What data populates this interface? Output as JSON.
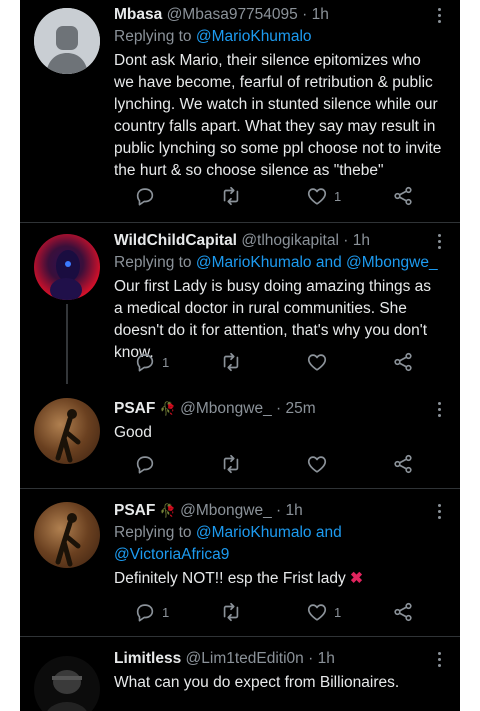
{
  "tweets": [
    {
      "name": "Mbasa",
      "handle": "@Mbasa97754095",
      "time": "· 1h",
      "replying_prefix": "Replying to ",
      "replying_to": "@MarioKhumalo",
      "text": "Dont ask Mario, their silence epitomizes who we have become, fearful of retribution & public lynching. We watch in stunted silence while our country falls apart. What they say may result in public lynching so some ppl choose not to invite the hurt & so choose silence as \"thebe\"",
      "replies": "",
      "retweets": "",
      "likes": "1"
    },
    {
      "name": "WildChildCapital",
      "handle": "@tlhogikapital",
      "time": "· 1h",
      "replying_prefix": "Replying to ",
      "replying_to": "@MarioKhumalo and @Mbongwe_",
      "text": "Our first Lady is busy doing amazing things as a medical doctor in rural communities. She doesn't do it for attention, that's why you don't know.",
      "replies": "1",
      "retweets": "",
      "likes": ""
    },
    {
      "name": "PSAF",
      "name_emoji": "🥀",
      "handle": "@Mbongwe_",
      "time": "· 25m",
      "text": "Good",
      "replies": "",
      "retweets": "",
      "likes": ""
    },
    {
      "name": "PSAF",
      "name_emoji": "🥀",
      "handle": "@Mbongwe_",
      "time": "· 1h",
      "replying_prefix": "Replying to ",
      "replying_to_line1": "@MarioKhumalo and",
      "replying_to_line2": "@VictoriaAfrica9",
      "text": "Definitely NOT!! esp the Frist lady",
      "text_emoji": "✖",
      "replies": "1",
      "retweets": "",
      "likes": "1"
    },
    {
      "name": "Limitless",
      "handle": "@Lim1tedEditi0n",
      "time": "· 1h",
      "text": "What can you do expect from Billionaires."
    }
  ],
  "icons": {
    "reply": "reply-icon",
    "retweet": "retweet-icon",
    "like": "heart-icon",
    "share": "share-icon",
    "more": "more-icon"
  },
  "colors": {
    "background": "#000000",
    "text": "#e7e9ea",
    "secondary": "#8b9299",
    "link": "#1d9bf0"
  }
}
